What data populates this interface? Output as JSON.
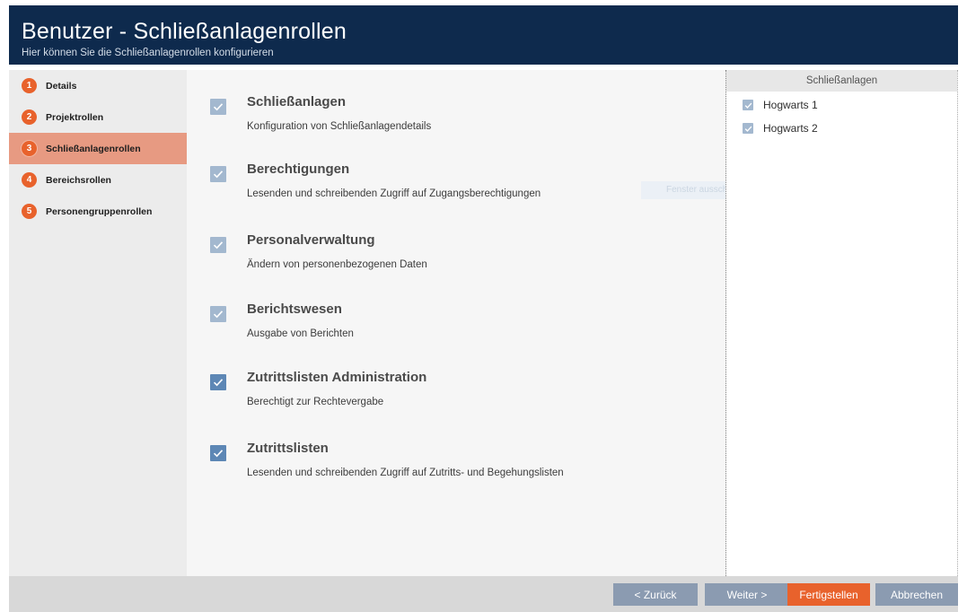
{
  "header": {
    "title": "Benutzer - Schließanlagenrollen",
    "subtitle": "Hier können Sie die Schließanlagenrollen konfigurieren"
  },
  "sidebar": {
    "items": [
      {
        "num": "1",
        "label": "Details",
        "active": false
      },
      {
        "num": "2",
        "label": "Projektrollen",
        "active": false
      },
      {
        "num": "3",
        "label": "Schließanlagenrollen",
        "active": true
      },
      {
        "num": "4",
        "label": "Bereichsrollen",
        "active": false
      },
      {
        "num": "5",
        "label": "Personengruppenrollen",
        "active": false
      }
    ]
  },
  "permissions": [
    {
      "title": "Schließanlagen",
      "description": "Konfiguration von Schließanlagendetails",
      "checked": true,
      "enabled": false
    },
    {
      "title": "Berechtigungen",
      "description": "Lesenden und schreibenden Zugriff auf Zugangsberechtigungen",
      "checked": true,
      "enabled": false
    },
    {
      "title": "Personalverwaltung",
      "description": "Ändern von personenbezogenen Daten",
      "checked": true,
      "enabled": false
    },
    {
      "title": "Berichtswesen",
      "description": "Ausgabe von Berichten",
      "checked": true,
      "enabled": false
    },
    {
      "title": "Zutrittslisten Administration",
      "description": "Berechtigt zur Rechtevergabe",
      "checked": true,
      "enabled": true
    },
    {
      "title": "Zutrittslisten",
      "description": "Lesenden und schreibenden Zugriff auf Zutritts- und Begehungslisten",
      "checked": true,
      "enabled": true
    }
  ],
  "locking_systems": {
    "header": "Schließanlagen",
    "items": [
      {
        "label": "Hogwarts 1",
        "checked": true
      },
      {
        "label": "Hogwarts 2",
        "checked": true
      }
    ]
  },
  "ghost_tooltip": "Fenster ausschneiden",
  "footer": {
    "back_label": "< Zurück",
    "next_label": "Weiter >",
    "finish_label": "Fertigstellen",
    "cancel_label": "Abbrechen"
  },
  "colors": {
    "header_bg": "#0e2a4d",
    "accent_orange": "#e8622c",
    "active_step_bg": "#e79a82",
    "checkbox_disabled": "#a3b8cf",
    "checkbox_enabled": "#5d87b5",
    "button_gray": "#8b9bb1"
  }
}
